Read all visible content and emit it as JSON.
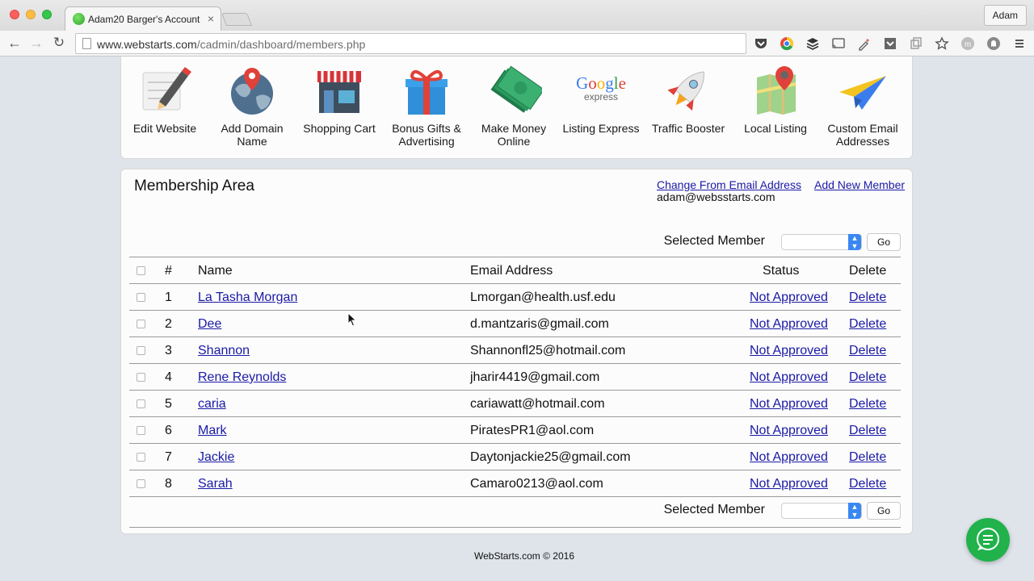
{
  "browser": {
    "tab_title": "Adam20 Barger's Account",
    "tab_close": "×",
    "profile_name": "Adam",
    "url_host": "www.webstarts.com",
    "url_path": "/cadmin/dashboard/members.php"
  },
  "tools": [
    {
      "label": "Edit Website",
      "icon": "edit-pencil-icon"
    },
    {
      "label": "Add Domain Name",
      "icon": "globe-pin-icon"
    },
    {
      "label": "Shopping Cart",
      "icon": "storefront-icon"
    },
    {
      "label": "Bonus Gifts & Advertising",
      "icon": "gift-icon"
    },
    {
      "label": "Make Money Online",
      "icon": "money-icon"
    },
    {
      "label": "Listing Express",
      "icon": "google-express-logo"
    },
    {
      "label": "Traffic Booster",
      "icon": "rocket-icon"
    },
    {
      "label": "Local Listing",
      "icon": "map-pin-icon"
    },
    {
      "label": "Custom Email Addresses",
      "icon": "paper-plane-icon"
    }
  ],
  "google_logo": {
    "word": "Google",
    "sub": "express"
  },
  "membership": {
    "title": "Membership Area",
    "change_email_link": "Change From Email Address",
    "add_member_link": "Add New Member",
    "from_email": "adam@websstarts.com",
    "selected_member_label": "Selected Member",
    "go_label": "Go",
    "columns": {
      "num": "#",
      "name": "Name",
      "email": "Email Address",
      "status": "Status",
      "delete": "Delete"
    },
    "members": [
      {
        "num": "1",
        "name": "La Tasha Morgan",
        "email": "Lmorgan@health.usf.edu",
        "status": "Not Approved",
        "delete": "Delete"
      },
      {
        "num": "2",
        "name": "Dee",
        "email": "d.mantzaris@gmail.com",
        "status": "Not Approved",
        "delete": "Delete"
      },
      {
        "num": "3",
        "name": "Shannon",
        "email": "Shannonfl25@hotmail.com",
        "status": "Not Approved",
        "delete": "Delete"
      },
      {
        "num": "4",
        "name": "Rene Reynolds",
        "email": "jharir4419@gmail.com",
        "status": "Not Approved",
        "delete": "Delete"
      },
      {
        "num": "5",
        "name": "caria",
        "email": "cariawatt@hotmail.com",
        "status": "Not Approved",
        "delete": "Delete"
      },
      {
        "num": "6",
        "name": "Mark",
        "email": "PiratesPR1@aol.com",
        "status": "Not Approved",
        "delete": "Delete"
      },
      {
        "num": "7",
        "name": "Jackie",
        "email": "Daytonjackie25@gmail.com",
        "status": "Not Approved",
        "delete": "Delete"
      },
      {
        "num": "8",
        "name": "Sarah",
        "email": "Camaro0213@aol.com",
        "status": "Not Approved",
        "delete": "Delete"
      }
    ]
  },
  "footer": "WebStarts.com © 2016",
  "colors": {
    "link": "#1a1aa6",
    "chat": "#21b24b",
    "select_accent": "#3a87f1"
  }
}
